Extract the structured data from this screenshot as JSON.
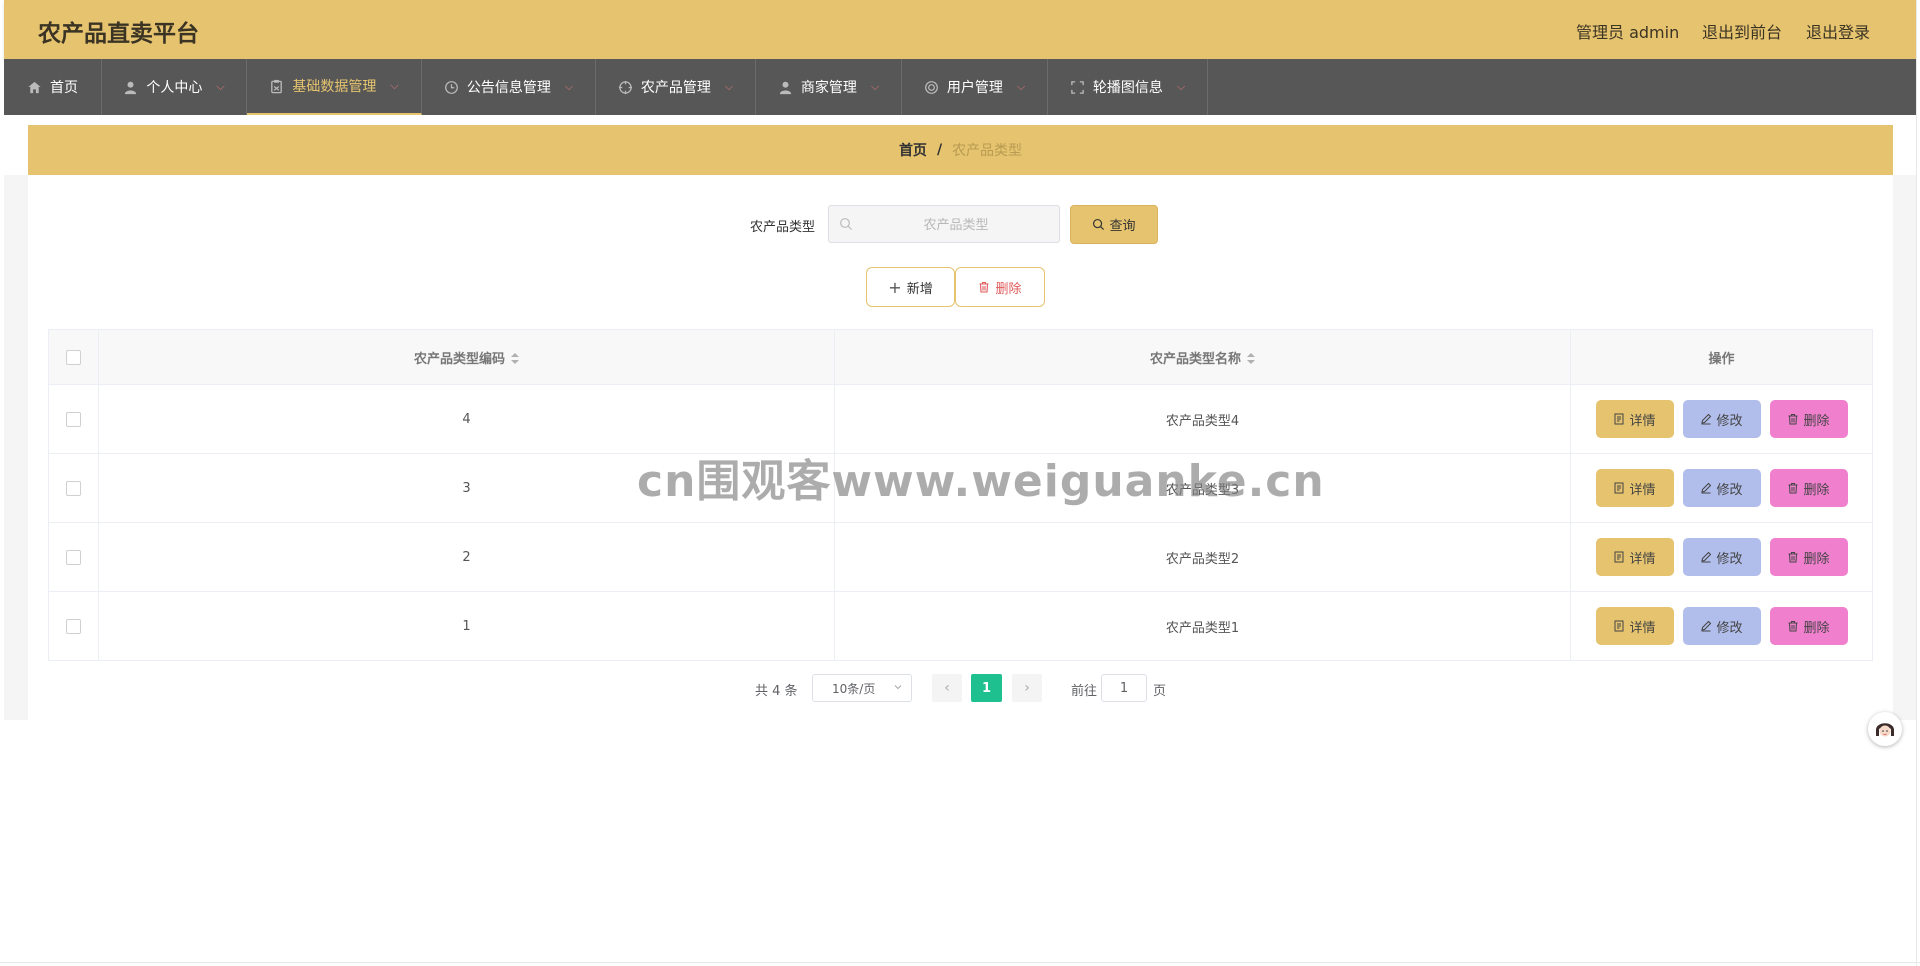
{
  "header": {
    "app_title": "农产品直卖平台",
    "admin_label": "管理员 admin",
    "front_link": "退出到前台",
    "logout_link": "退出登录"
  },
  "nav": {
    "items": [
      {
        "label": "首页",
        "icon": "home-icon",
        "dropdown": false,
        "active": false
      },
      {
        "label": "个人中心",
        "icon": "user-icon",
        "dropdown": true,
        "active": false
      },
      {
        "label": "基础数据管理",
        "icon": "clipboard-icon",
        "dropdown": true,
        "active": true
      },
      {
        "label": "公告信息管理",
        "icon": "clock-icon",
        "dropdown": true,
        "active": false
      },
      {
        "label": "农产品管理",
        "icon": "target-icon",
        "dropdown": true,
        "active": false
      },
      {
        "label": "商家管理",
        "icon": "user-icon",
        "dropdown": true,
        "active": false
      },
      {
        "label": "用户管理",
        "icon": "lifebuoy-icon",
        "dropdown": true,
        "active": false
      },
      {
        "label": "轮播图信息",
        "icon": "fullscreen-icon",
        "dropdown": true,
        "active": false
      }
    ]
  },
  "breadcrumb": {
    "home": "首页",
    "separator": "/",
    "current": "农产品类型"
  },
  "search": {
    "label": "农产品类型",
    "placeholder": "农产品类型",
    "value": "",
    "button_label": "查询"
  },
  "actions": {
    "add_label": "新增",
    "delete_label": "删除"
  },
  "table": {
    "columns": [
      "农产品类型编码",
      "农产品类型名称",
      "操作"
    ],
    "rows": [
      {
        "code": "4",
        "name": "农产品类型4"
      },
      {
        "code": "3",
        "name": "农产品类型3"
      },
      {
        "code": "2",
        "name": "农产品类型2"
      },
      {
        "code": "1",
        "name": "农产品类型1"
      }
    ],
    "row_actions": {
      "detail": "详情",
      "edit": "修改",
      "delete": "删除"
    }
  },
  "pagination": {
    "total": "共 4 条",
    "page_size": "10条/页",
    "current_page": "1",
    "goto_label": "前往",
    "goto_value": "1",
    "goto_suffix": "页"
  },
  "watermark": "cn围观客www.weiguanke.cn",
  "colors": {
    "header_bg": "#e6c46f",
    "nav_bg": "#575757",
    "accent": "#e6c46f",
    "edit_btn": "#b1bdea",
    "delete_btn": "#f07fce",
    "active_page": "#1ec08f"
  }
}
